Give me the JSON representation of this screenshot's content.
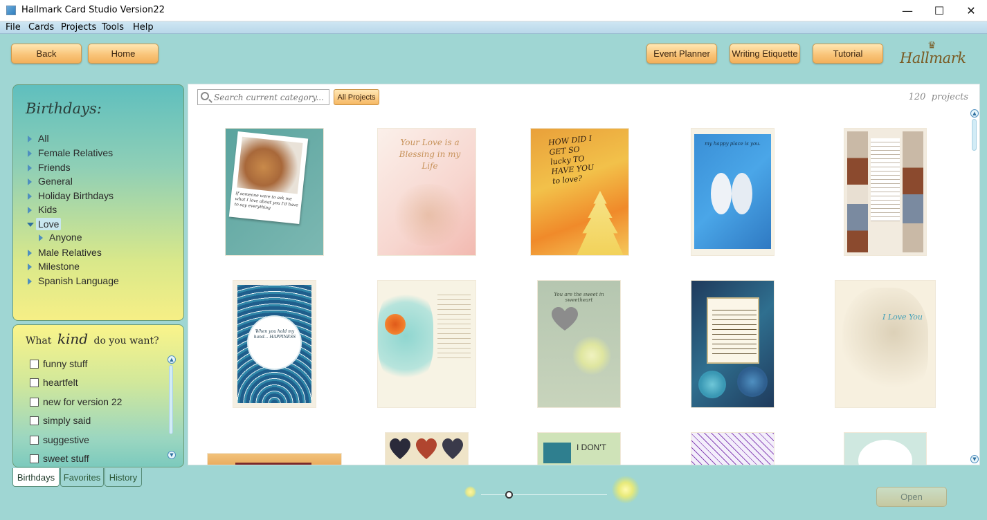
{
  "window": {
    "title": "Hallmark Card Studio Version22",
    "minimize": "—",
    "maximize": "☐",
    "close": "✕"
  },
  "menu": [
    "File",
    "Cards",
    "Projects",
    "Tools",
    "Help"
  ],
  "nav": {
    "back": "Back",
    "home": "Home",
    "event_planner": "Event Planner",
    "writing_etiquette": "Writing Etiquette",
    "tutorial": "Tutorial",
    "logo": "Hallmark",
    "logo_crown": "♛"
  },
  "category": {
    "title": "Birthdays:",
    "items": [
      "All",
      "Female Relatives",
      "Friends",
      "General",
      "Holiday Birthdays",
      "Kids",
      "Love",
      "Anyone",
      "Male Relatives",
      "Milestone",
      "Spanish Language"
    ],
    "selected": "Love"
  },
  "kind": {
    "title_before": "What",
    "title_script": "kind",
    "title_after": "do you want?",
    "options": [
      "funny stuff",
      "heartfelt",
      "new for version 22",
      "simply said",
      "suggestive",
      "sweet stuff"
    ]
  },
  "tabs": [
    "Birthdays",
    "Favorites",
    "History"
  ],
  "active_tab": "Birthdays",
  "search": {
    "placeholder": "Search current category...",
    "all_projects": "All Projects"
  },
  "project_count": "120",
  "project_count_label": "projects",
  "cards": [
    {
      "text": "If someone were to ask me what I love about you I'd have to say everything"
    },
    {
      "text": "Your Love is a Blessing in my Life"
    },
    {
      "text": "HOW DID I GET SO lucky TO HAVE YOU to love?"
    },
    {
      "text": "my happy place is you."
    },
    {
      "text": ""
    },
    {
      "text": "When you hold my hand... HAPPINESS"
    },
    {
      "text": ""
    },
    {
      "text": "You are the sweet in sweetheart"
    },
    {
      "text": ""
    },
    {
      "text": "I Love You"
    },
    {
      "text": ""
    },
    {
      "text": ""
    },
    {
      "text": "I DON'T"
    },
    {
      "text": ""
    },
    {
      "text": ""
    }
  ],
  "open_button": "Open"
}
